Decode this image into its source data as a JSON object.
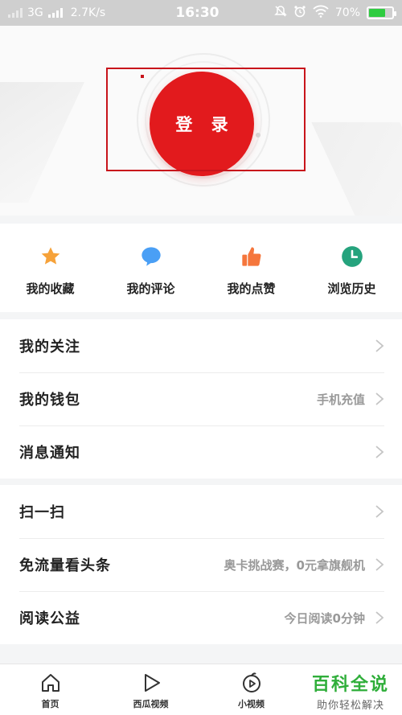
{
  "status_bar": {
    "network": "3G",
    "speed": "2.7K/s",
    "time": "16:30",
    "battery": "70%"
  },
  "login": {
    "label": "登 录"
  },
  "quick_actions": [
    {
      "label": "我的收藏",
      "icon": "star-icon",
      "color": "#f6a23a"
    },
    {
      "label": "我的评论",
      "icon": "comment-bubble-icon",
      "color": "#4a9ff5"
    },
    {
      "label": "我的点赞",
      "icon": "thumbs-up-icon",
      "color": "#f5763c"
    },
    {
      "label": "浏览历史",
      "icon": "clock-icon",
      "color": "#25a37d"
    }
  ],
  "menu_group_1": [
    {
      "label": "我的关注",
      "value": ""
    },
    {
      "label": "我的钱包",
      "value": "手机充值"
    },
    {
      "label": "消息通知",
      "value": ""
    }
  ],
  "menu_group_2": [
    {
      "label": "扫一扫",
      "value": ""
    },
    {
      "label": "免流量看头条",
      "value": "奥卡挑战赛，0元拿旗舰机"
    },
    {
      "label": "阅读公益",
      "value": "今日阅读0分钟"
    }
  ],
  "bottom_nav": [
    {
      "label": "首页",
      "icon": "home-icon"
    },
    {
      "label": "西瓜视频",
      "icon": "play-icon"
    },
    {
      "label": "小视频",
      "icon": "short-video-icon"
    },
    {
      "label": "",
      "icon": ""
    }
  ],
  "watermark": {
    "title": "百科全说",
    "subtitle": "助你轻松解决"
  },
  "colors": {
    "accent_red": "#e21a1d",
    "watermark_green": "#2fae3a"
  }
}
